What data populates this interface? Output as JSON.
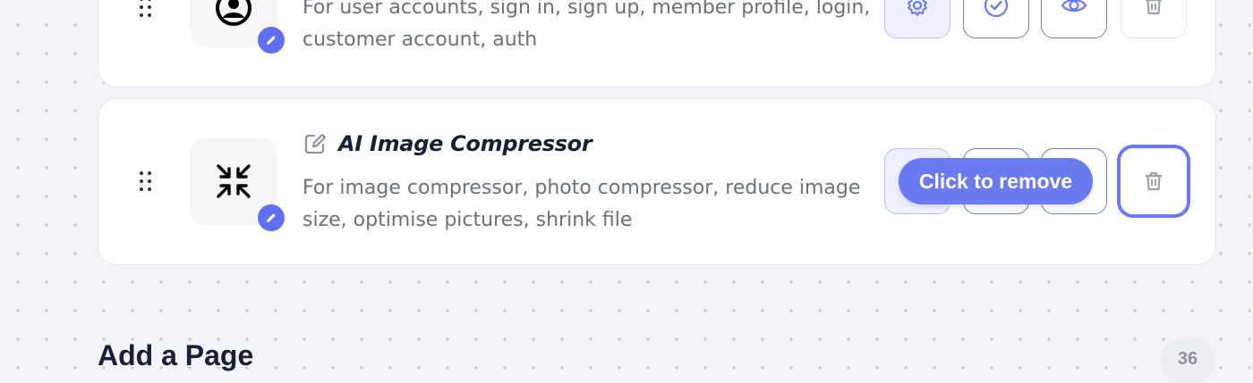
{
  "items": [
    {
      "title": "",
      "description": "For user accounts, sign in, sign up, member profile, login, customer account, auth",
      "icon": "user-circle-icon"
    },
    {
      "title": "AI Image Compressor",
      "description": "For image compressor, photo compressor, reduce image size, optimise pictures, shrink file",
      "icon": "compress-icon"
    }
  ],
  "tooltip": {
    "label": "Click to remove"
  },
  "section": {
    "add_page_label": "Add a Page",
    "count": "36"
  },
  "colors": {
    "accent": "#6a7af0",
    "badge": "#5f71f0",
    "title": "#172036",
    "muted": "#6b7080"
  }
}
